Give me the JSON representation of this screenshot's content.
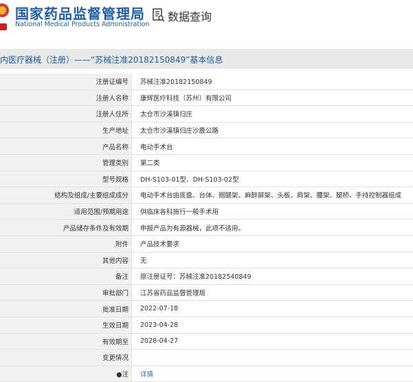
{
  "header": {
    "site_title": "国家药品监督管理局",
    "site_subtitle": "National Medical Products Administration",
    "query_label": "数据查询"
  },
  "page_title": "内医疗器械（注册）——“苏械注准20182150849”基本信息",
  "rows": [
    {
      "label": "注册证编号",
      "value": "苏械注准20182150849"
    },
    {
      "label": "注册人名称",
      "value": "康辉医疗科技（苏州）有限公司"
    },
    {
      "label": "注册人住所",
      "value": "太仓市沙溪镇归庄"
    },
    {
      "label": "生产地址",
      "value": "太仓市沙溪镇归庄沙鹿公路"
    },
    {
      "label": "产品名称",
      "value": "电动手术台"
    },
    {
      "label": "管理类别",
      "value": "第二类"
    },
    {
      "label": "型号规格",
      "value": "DH-S103-01型、DH-S103-02型"
    },
    {
      "label": "结构及组成/主要组成成分",
      "value": "电动手术台由底盘、台体、搁腿架、麻醉屏架、头板、肩架、腰架、腿桥、手持控制器组成"
    },
    {
      "label": "适用范围/预期用途",
      "value": "供临床各科施行一般手术用"
    },
    {
      "label": "产品储存条件及有效期",
      "value": "申报产品为有源器械，此项不适用。"
    },
    {
      "label": "附件",
      "value": "产品技术要求"
    },
    {
      "label": "其他内容",
      "value": "无"
    },
    {
      "label": "备注",
      "value": "原注册证号：苏械注准20182540849"
    },
    {
      "label": "审批部门",
      "value": "江苏省药品监督管理局"
    },
    {
      "label": "批准日期",
      "value": "2022-07-18"
    },
    {
      "label": "生效日期",
      "value": "2023-04-28"
    },
    {
      "label": "有效期至",
      "value": "2028-04-27"
    },
    {
      "label": "变更情况",
      "value": ""
    },
    {
      "label": "●注",
      "value": "详情"
    }
  ]
}
